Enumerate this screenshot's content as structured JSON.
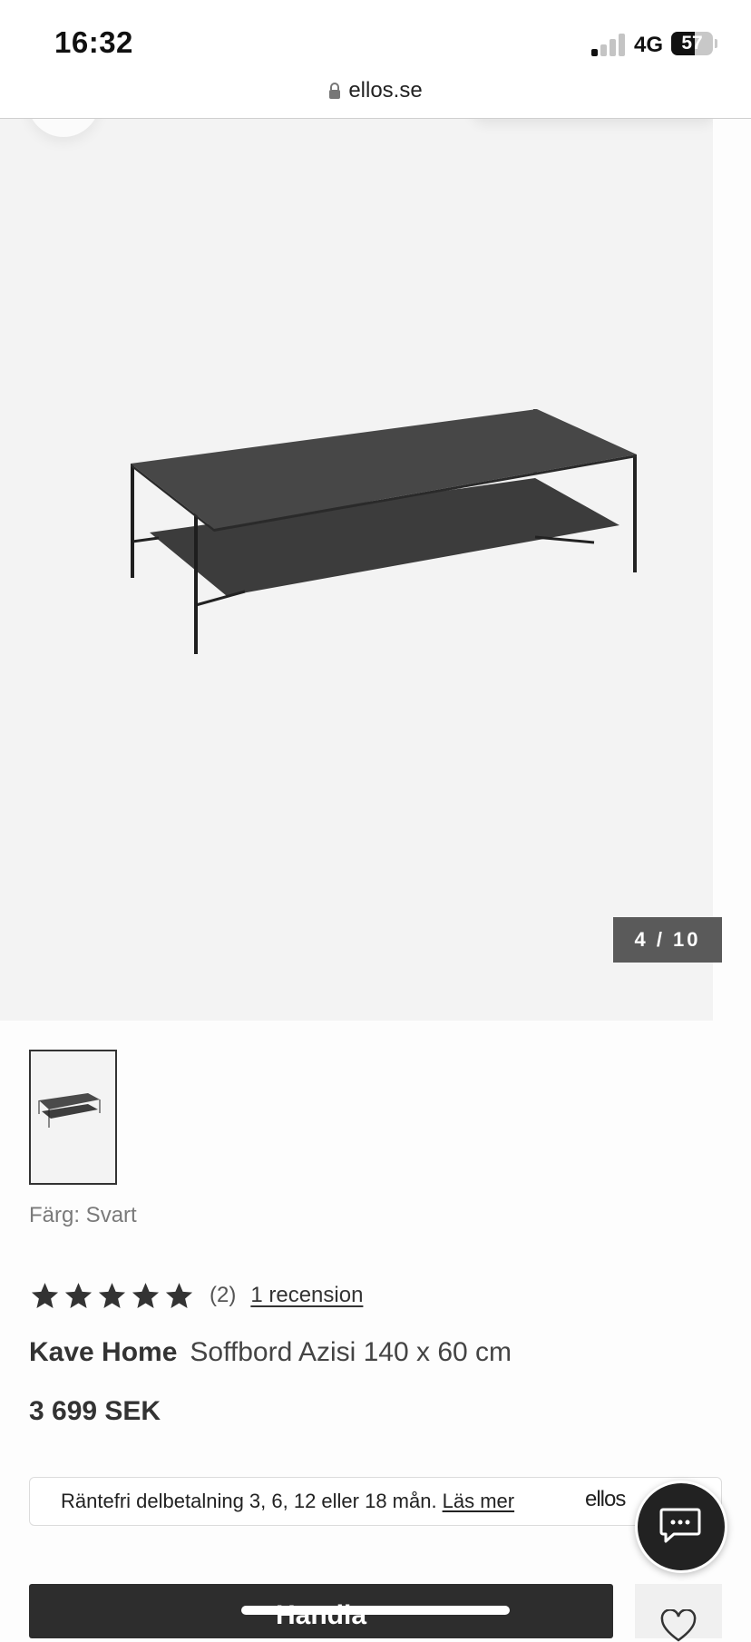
{
  "status_bar": {
    "time": "16:32",
    "network": "4G",
    "battery": "57",
    "battery_level": 0.57
  },
  "browser": {
    "url": "ellos.se"
  },
  "gallery": {
    "counter": "4 / 10",
    "current_image": 4,
    "total_images": 10
  },
  "product": {
    "color_label": "Färg: Svart",
    "rating_stars": 5,
    "rating_count": "(2)",
    "reviews_link": "1 recension",
    "brand": "Kave Home",
    "name": "Soffbord Azisi 140 x 60 cm",
    "price": "3 699 SEK"
  },
  "finance": {
    "text": "Räntefri delbetalning 3, 6, 12 eller 18 mån.",
    "link": "Läs mer",
    "logo": "ellos"
  },
  "actions": {
    "buy_label": "Handla"
  },
  "icons": {
    "lock": "lock-icon",
    "chat": "chat-bubble-icon",
    "wishlist": "heart-icon",
    "star": "star-icon"
  },
  "colors": {
    "buy_button": "#2d2d2d",
    "counter_badge": "#5a5a5a",
    "image_background": "#f3f3f3"
  }
}
